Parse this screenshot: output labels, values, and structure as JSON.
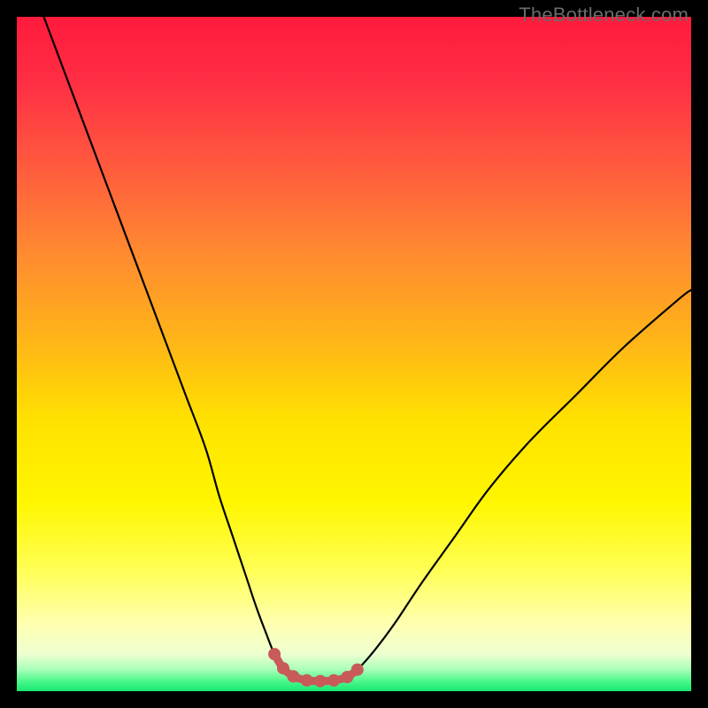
{
  "watermark": "TheBottleneck.com",
  "colors": {
    "frame": "#000000",
    "curve": "#000000",
    "marker_stroke": "#c85a5a",
    "marker_fill": "#c85a5a",
    "gradient_stops": [
      {
        "offset": 0.0,
        "color": "#ff1a3c"
      },
      {
        "offset": 0.1,
        "color": "#ff2f44"
      },
      {
        "offset": 0.22,
        "color": "#ff5a3e"
      },
      {
        "offset": 0.35,
        "color": "#ff8a30"
      },
      {
        "offset": 0.48,
        "color": "#ffb518"
      },
      {
        "offset": 0.6,
        "color": "#ffe200"
      },
      {
        "offset": 0.72,
        "color": "#fff600"
      },
      {
        "offset": 0.82,
        "color": "#ffff55"
      },
      {
        "offset": 0.9,
        "color": "#ffffb0"
      },
      {
        "offset": 0.945,
        "color": "#eeffd0"
      },
      {
        "offset": 0.968,
        "color": "#a8ffb8"
      },
      {
        "offset": 0.985,
        "color": "#4cf88a"
      },
      {
        "offset": 1.0,
        "color": "#17e772"
      }
    ]
  },
  "chart_data": {
    "type": "line",
    "title": "",
    "xlabel": "",
    "ylabel": "",
    "xlim": [
      0,
      100
    ],
    "ylim": [
      0,
      100
    ],
    "series": [
      {
        "name": "bottleneck-curve",
        "x": [
          4,
          7,
          10,
          13,
          16,
          19,
          22,
          25,
          28,
          30,
          32,
          34,
          35.5,
          37,
          38.2,
          39.5,
          41,
          43,
          45,
          47,
          49,
          50.5,
          53,
          56,
          60,
          65,
          70,
          76,
          83,
          90,
          98,
          100
        ],
        "y": [
          100,
          92,
          84,
          76,
          68,
          60,
          52,
          44,
          36,
          29,
          23,
          17,
          12.5,
          8.5,
          5.5,
          3.4,
          2.2,
          1.6,
          1.5,
          1.6,
          2.1,
          3.2,
          6,
          10,
          16,
          23,
          30,
          37,
          44,
          51,
          58,
          59.5
        ]
      }
    ],
    "markers": {
      "name": "optimal-range",
      "x": [
        38.2,
        39.5,
        41,
        43,
        45,
        47,
        49,
        50.5
      ],
      "y": [
        5.5,
        3.4,
        2.2,
        1.6,
        1.5,
        1.6,
        2.1,
        3.2
      ]
    }
  }
}
